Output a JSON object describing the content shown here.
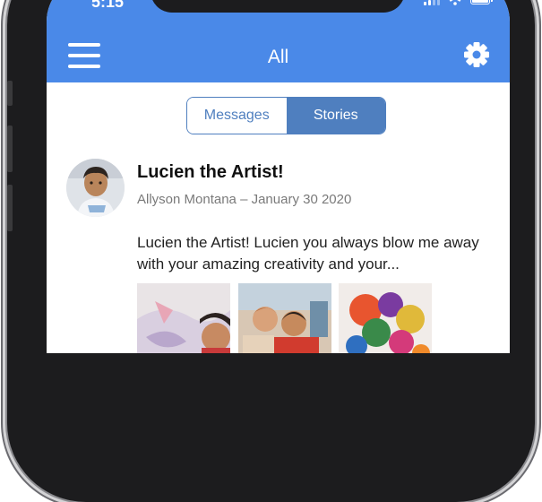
{
  "status_bar": {
    "time": "5:15",
    "icons": [
      "cellular-signal-icon",
      "wifi-icon",
      "battery-icon"
    ]
  },
  "header": {
    "title": "All",
    "left_icon": "hamburger-menu-icon",
    "right_icon": "gear-icon",
    "background_color": "#4a89e8"
  },
  "tabs": {
    "items": [
      {
        "label": "Messages",
        "selected": false
      },
      {
        "label": "Stories",
        "selected": true
      }
    ],
    "accent_color": "#4f7fbf"
  },
  "post": {
    "title": "Lucien the Artist!",
    "meta": "Allyson Montana – January 30 2020",
    "body": "Lucien the Artist! Lucien you always blow me away with your amazing creativity and your...",
    "images": [
      "photo-thumbnail",
      "photo-thumbnail",
      "photo-thumbnail"
    ]
  }
}
